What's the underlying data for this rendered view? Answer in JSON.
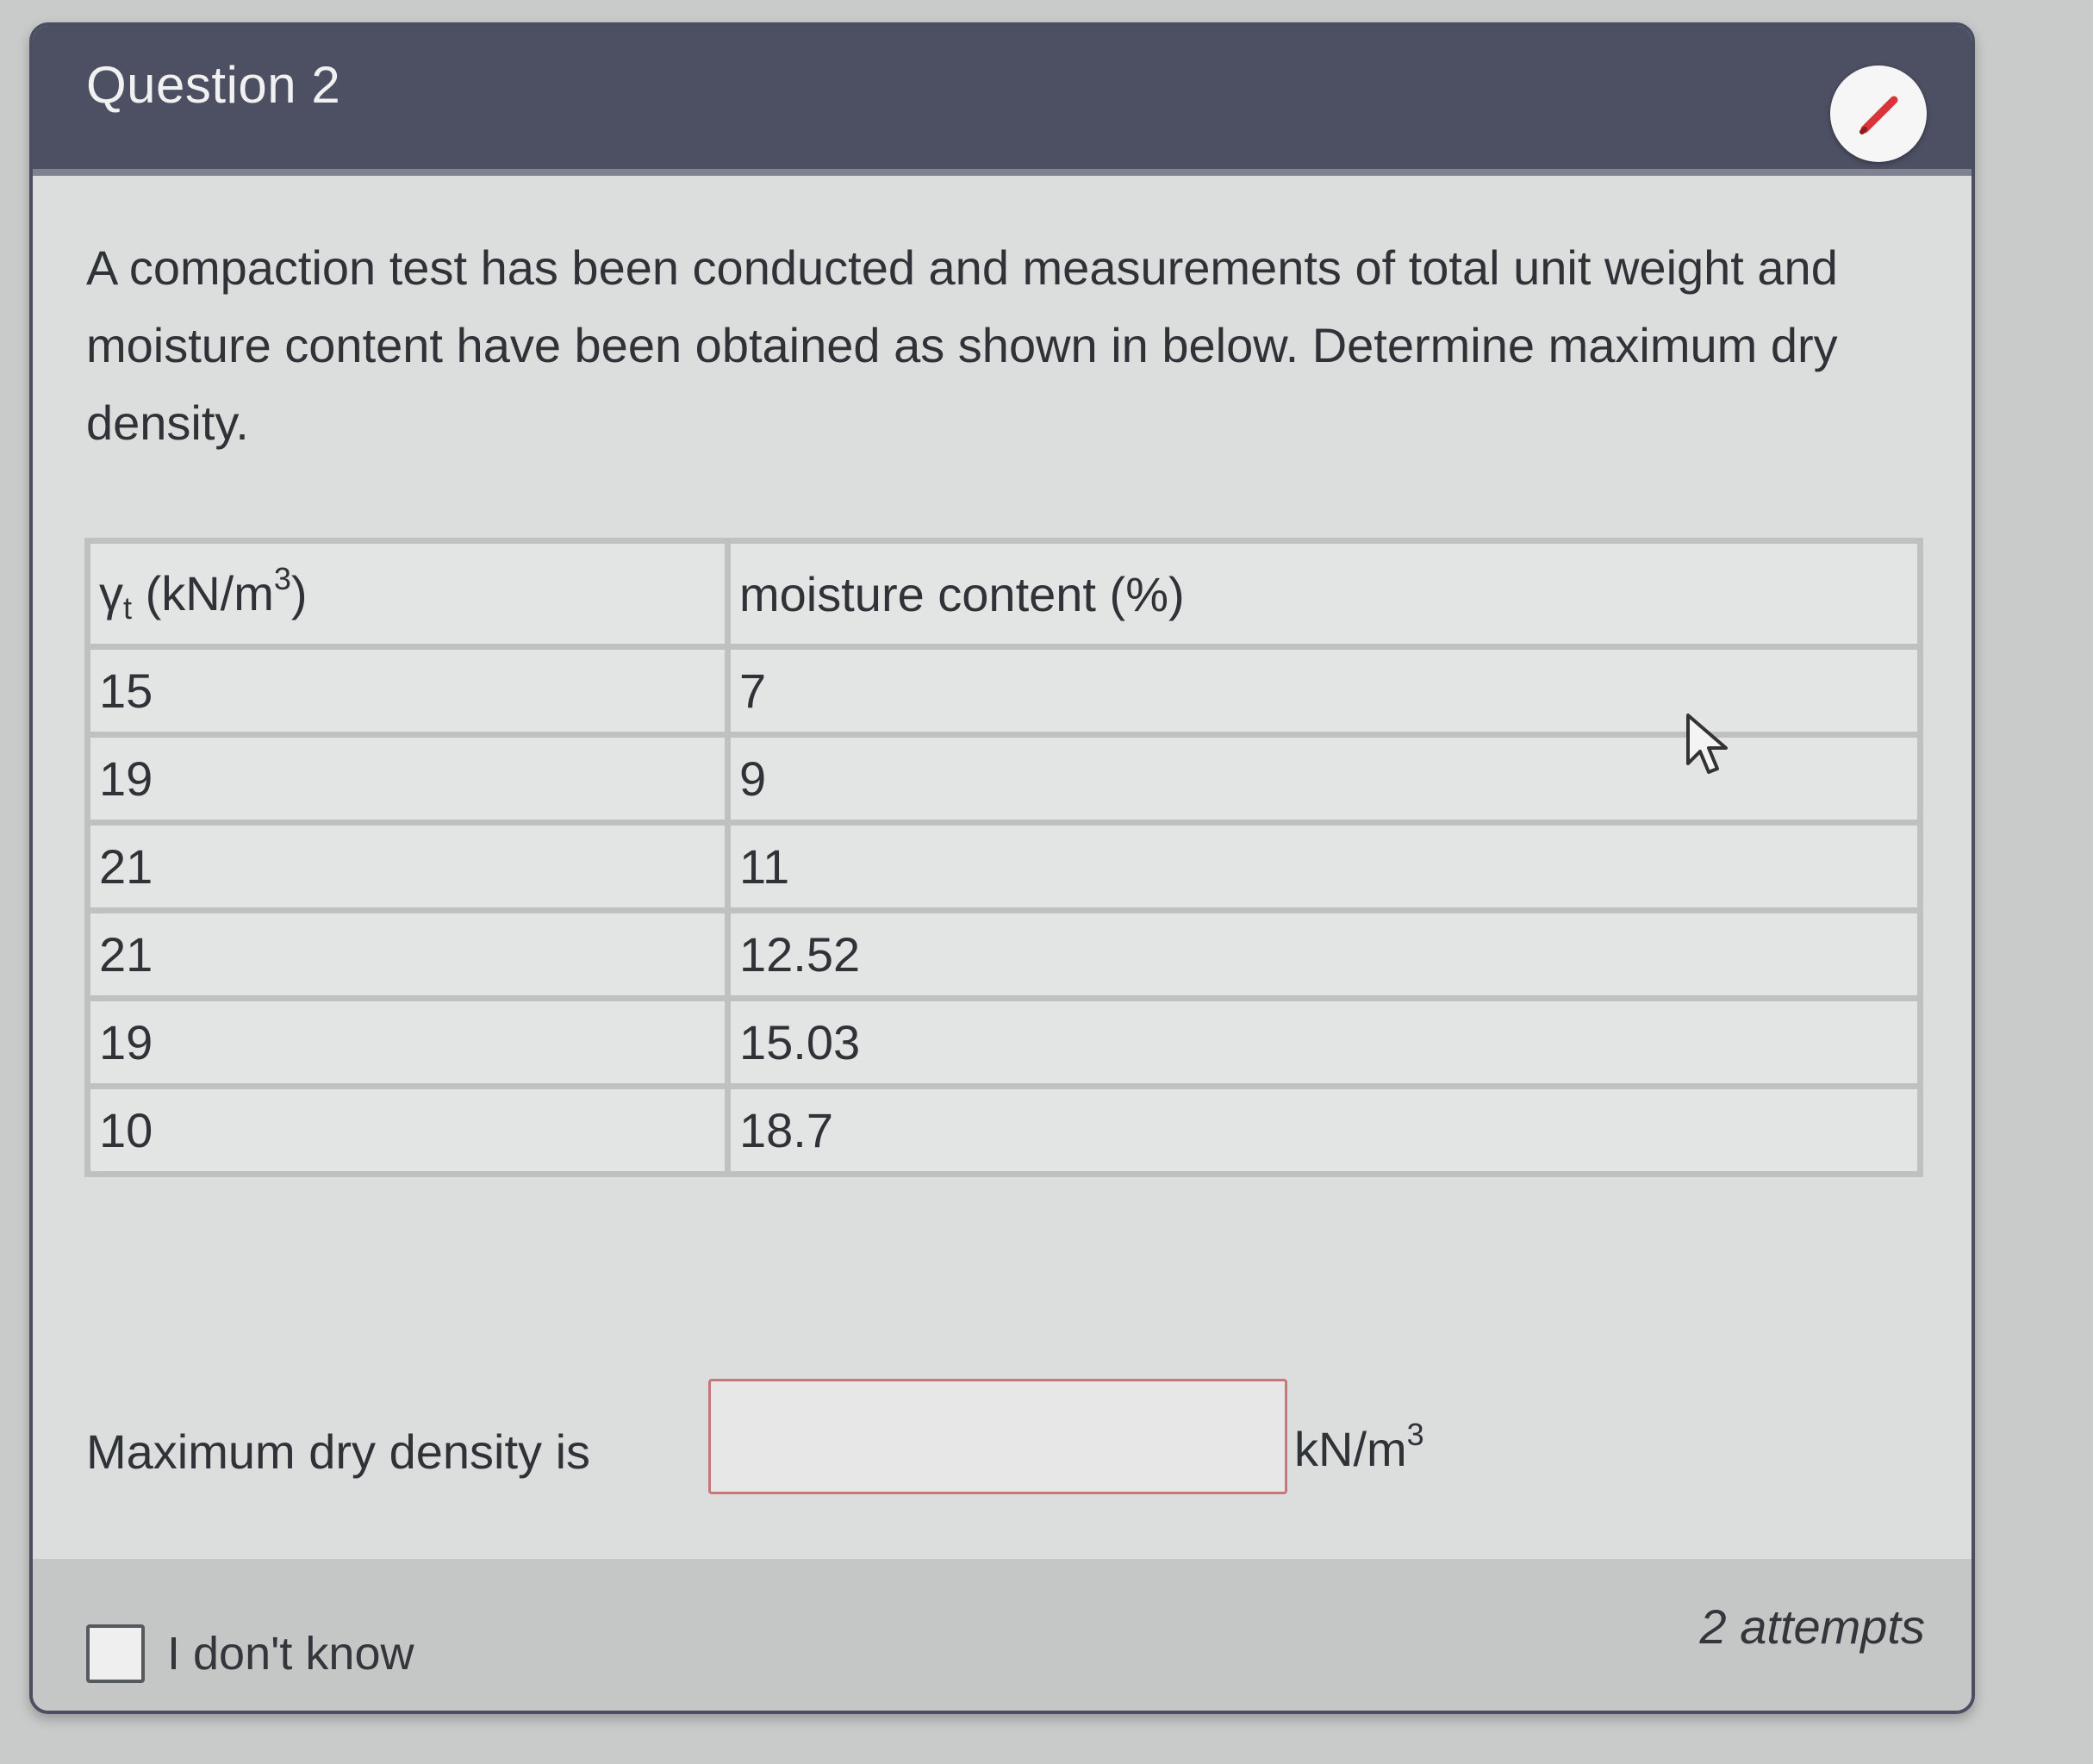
{
  "question": {
    "title": "Question 2",
    "text": "A compaction test has been conducted and measurements of total unit weight and moisture content have been obtained as shown in below. Determine maximum dry density."
  },
  "table": {
    "header_col1_symbol": "γ",
    "header_col1_sub": "t",
    "header_col1_unit_pre": " (kN/m",
    "header_col1_unit_sup": "3",
    "header_col1_unit_post": ")",
    "header_col2": "moisture content (%)",
    "rows": [
      {
        "unit_weight": "15",
        "moisture": "7"
      },
      {
        "unit_weight": "19",
        "moisture": "9"
      },
      {
        "unit_weight": "21",
        "moisture": "11"
      },
      {
        "unit_weight": "21",
        "moisture": "12.52"
      },
      {
        "unit_weight": "19",
        "moisture": "15.03"
      },
      {
        "unit_weight": "10",
        "moisture": "18.7"
      }
    ]
  },
  "answer": {
    "label": "Maximum dry density is",
    "value": "",
    "unit_base": "kN/m",
    "unit_sup": "3"
  },
  "footer": {
    "dont_know_label": "I don't know",
    "attempts": "2 attempts"
  },
  "icons": {
    "edit": "pencil-icon",
    "cursor": "mouse-pointer-icon",
    "accent": "#d8343a",
    "header_bg": "#4c5062"
  }
}
